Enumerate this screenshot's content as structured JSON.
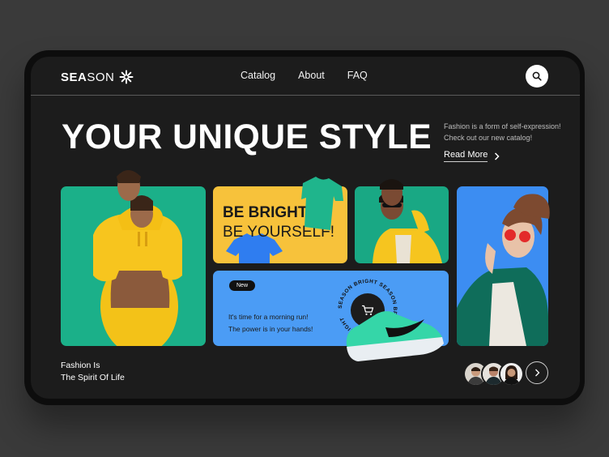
{
  "brand": {
    "logo_bold": "SEA",
    "logo_light": "SON",
    "logo_icon": "asterisk-icon"
  },
  "nav": {
    "items": [
      "Catalog",
      "About",
      "FAQ"
    ]
  },
  "hero": {
    "title": "YOUR UNIQUE STYLE",
    "description_line1": "Fashion is a form of self-expression!",
    "description_line2": "Check out our new catalog!",
    "read_more": "Read More"
  },
  "cards": {
    "bright_bold": "BE BRIGHT!",
    "bright_light": "BE YOURSELF!",
    "badge": "New",
    "run_line1": "It's time for a morning run!",
    "run_line2": "The power is in your hands!",
    "ring_text": "SEASON BRIGHT SEASON BRIGHT SEASON BRIGHT"
  },
  "footer": {
    "tagline_line1": "Fashion Is",
    "tagline_line2": "The Spirit Of Life"
  },
  "colors": {
    "background": "#3a3a3a",
    "screen": "#1c1c1c",
    "green_card": "#1bb089",
    "yellow_card": "#f7c23b",
    "blue_card": "#3c8df2",
    "run_card": "#4b9cf5",
    "shoe": "#35d6a8"
  },
  "icons": [
    "search-icon",
    "chevron-right-icon",
    "cart-icon",
    "asterisk-icon"
  ]
}
